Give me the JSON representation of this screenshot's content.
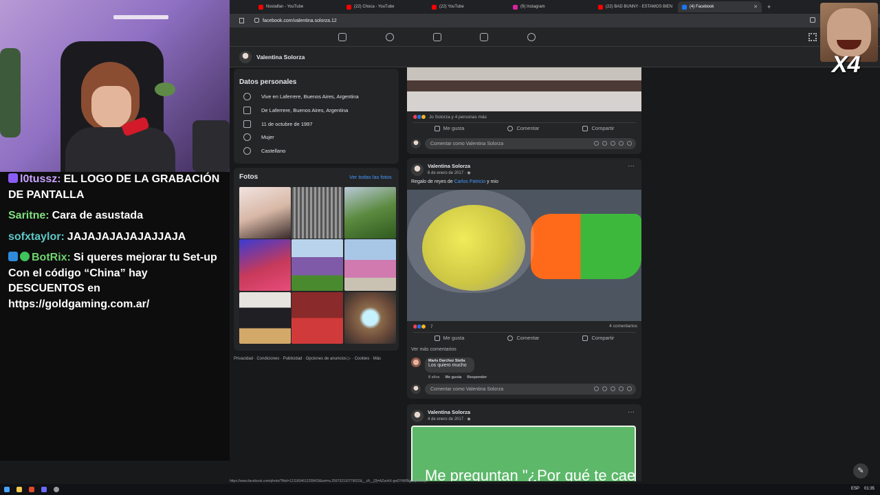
{
  "chat": [
    {
      "user": "l0tussz:",
      "text": "EL LOGO DE LA GRABACIÓN DE PANTALLA",
      "color": "#c7a3ff",
      "badge": "#8a5cf6",
      "badge_icon": "emote-icon"
    },
    {
      "user": "Saritne:",
      "text": "Cara de asustada",
      "color": "#7fe07f"
    },
    {
      "user": "sofxtaylor:",
      "text": "JAJAJAJAJAJAJJAJA",
      "color": "#5fc8c8"
    },
    {
      "user": "BotRix:",
      "text": "Si queres mejorar tu Set-up Con el código “China” hay DESCUENTOS en https://goldgaming.com.ar/",
      "color": "#6fd36f",
      "badge": "#2e8bdc",
      "badge_icon": "sword-icon"
    }
  ],
  "tabs": [
    {
      "label": "Nostalfan - YouTube",
      "color": "#ff0000"
    },
    {
      "label": "(22) Choca - YouTube",
      "color": "#ff0000"
    },
    {
      "label": "(22) YouTube",
      "color": "#ff0000"
    },
    {
      "label": "(9) Instagram",
      "color": "#d6249f"
    },
    {
      "label": "(22) BAD BUNNY - ESTAMOS BIEN",
      "color": "#ff0000"
    },
    {
      "label": "(4) Facebook",
      "color": "#1877f2"
    }
  ],
  "url": "facebook.com/valentina.solorza.12",
  "profile": {
    "name": "Valentina Solorza"
  },
  "personal": {
    "title": "Datos personales",
    "items": [
      {
        "icon": "location-pin-icon",
        "text": "Vive en Laferrere, Buenos Aires, Argentina"
      },
      {
        "icon": "home-icon",
        "text": "De Laferrere, Buenos Aires, Argentina"
      },
      {
        "icon": "cake-icon",
        "text": "11 de octubre de 1997"
      },
      {
        "icon": "gender-icon",
        "text": "Mujer"
      },
      {
        "icon": "language-icon",
        "text": "Castellano"
      }
    ]
  },
  "photos": {
    "title": "Fotos",
    "see_all": "Ver todas las fotos"
  },
  "footer": "Privacidad · Condiciones · Publicidad · Opciones de anuncios ▷ · Cookies · Más",
  "post1": {
    "reactions_text": "Jo Solorza y 4 personas más",
    "like": "Me gusta",
    "comment": "Comentar",
    "share": "Compartir",
    "comment_placeholder": "Comentar como Valentina Solorza"
  },
  "post2": {
    "author": "Valentina Solorza",
    "date": "6 de enero de 2017 · ",
    "text_before": "Regalo de reyes de ",
    "tag": "Carlos Patricio",
    "text_after": " y mio",
    "reactions_count": "7",
    "comments_count": "4 comentarios",
    "like": "Me gusta",
    "comment": "Comentar",
    "share": "Compartir",
    "see_more_comments": "Ver más comentarios",
    "commenter": "Maris Darchez Stella",
    "comment_text": "Los quiero mucho",
    "comment_age": "8 años",
    "comment_like": "Me gusta",
    "comment_reply": "Responder",
    "comment_placeholder": "Comentar como Valentina Solorza"
  },
  "post3": {
    "author": "Valentina Solorza",
    "date": "4 de enero de 2017 · ",
    "image_text": "Me preguntan \"¿Por qué te cae"
  },
  "status_url": "https://www.facebook.com/photo/?fbid=1211604612258429&set=a.259732110779022&__cft__[0]=AZaohX-gwDYiWRgpaqI9Okq...",
  "overlay": {
    "label": "X4"
  },
  "taskbar": {
    "lang": "ESP",
    "time": "01:35"
  }
}
